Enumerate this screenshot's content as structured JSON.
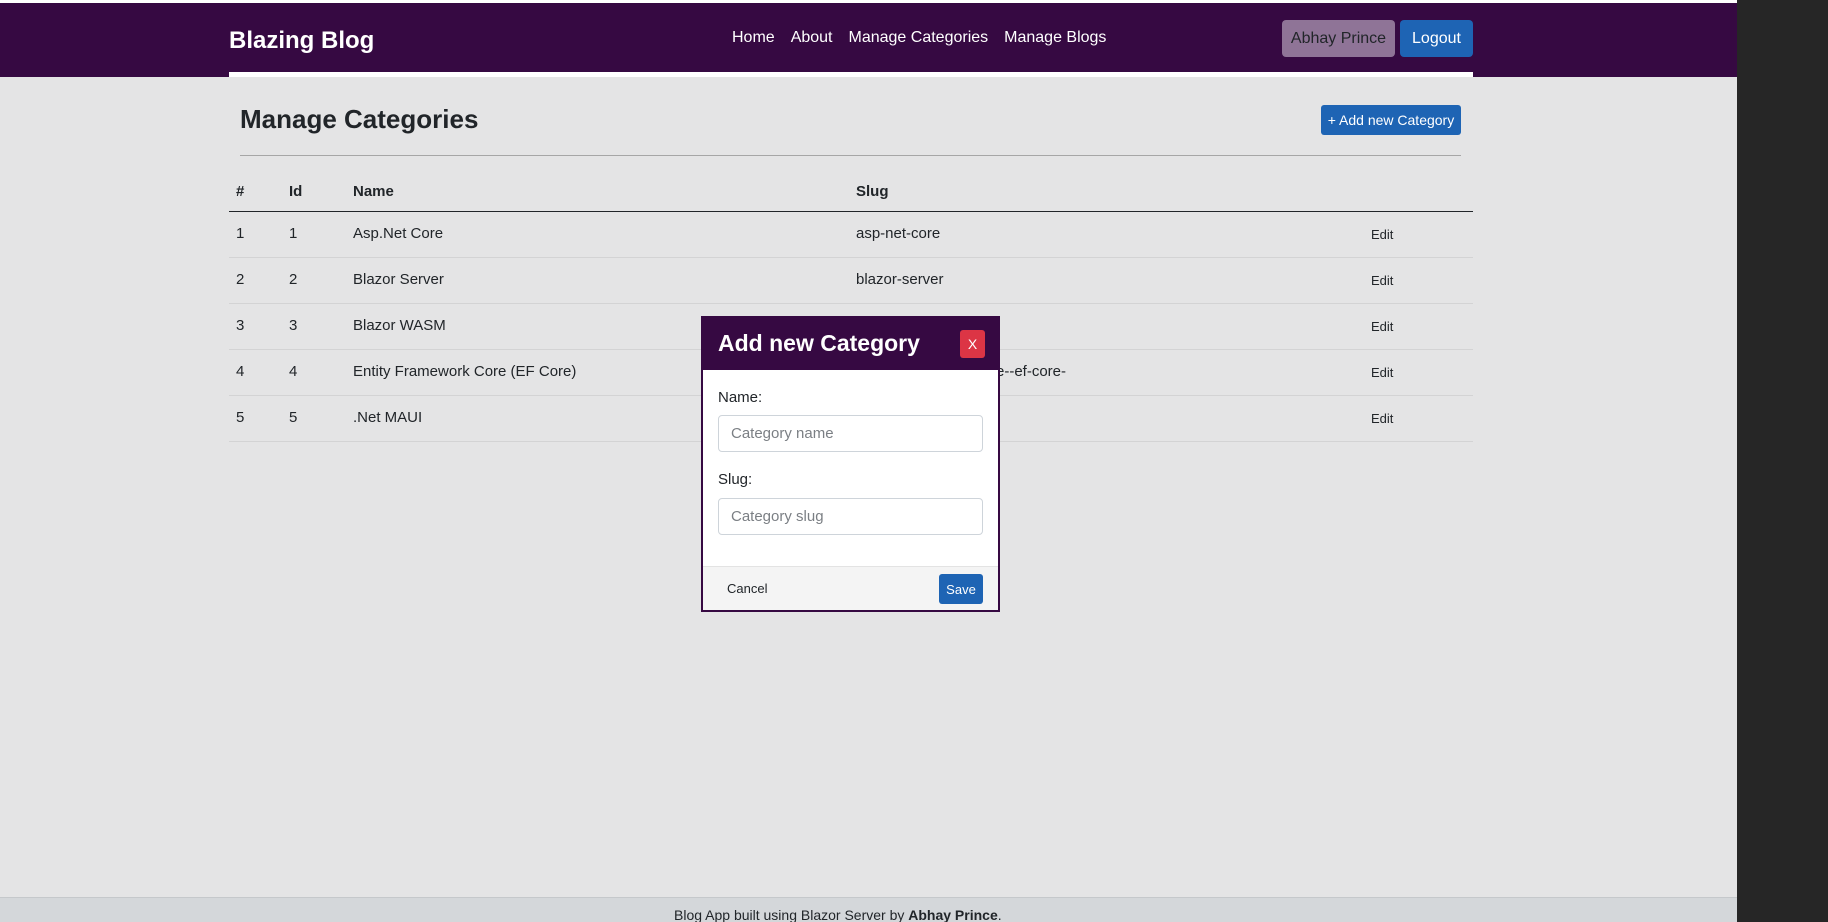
{
  "navbar": {
    "brand": "Blazing Blog",
    "links": [
      "Home",
      "About",
      "Manage Categories",
      "Manage Blogs"
    ],
    "user_name": "Abhay Prince",
    "logout_label": "Logout"
  },
  "main": {
    "title": "Manage Categories",
    "add_button_label": "+ Add new Category",
    "table": {
      "headers": {
        "num": "#",
        "id": "Id",
        "name": "Name",
        "slug": "Slug"
      },
      "rows": [
        {
          "num": "1",
          "id": "1",
          "name": "Asp.Net Core",
          "slug": "asp-net-core",
          "action": "Edit"
        },
        {
          "num": "2",
          "id": "2",
          "name": "Blazor Server",
          "slug": "blazor-server",
          "action": "Edit"
        },
        {
          "num": "3",
          "id": "3",
          "name": "Blazor WASM",
          "slug": "",
          "action": "Edit"
        },
        {
          "num": "4",
          "id": "4",
          "name": "Entity Framework Core (EF Core)",
          "slug": "e--ef-core-",
          "action": "Edit"
        },
        {
          "num": "5",
          "id": "5",
          "name": ".Net MAUI",
          "slug": "",
          "action": "Edit"
        }
      ]
    }
  },
  "modal": {
    "title": "Add new Category",
    "close_label": "X",
    "name_label": "Name:",
    "name_value": "",
    "name_placeholder": "Category name",
    "slug_label": "Slug:",
    "slug_value": "",
    "slug_placeholder": "Category slug",
    "cancel_label": "Cancel",
    "save_label": "Save"
  },
  "footer": {
    "prefix": "Blog App built using Blazor Server by ",
    "author": "Abhay Prince",
    "suffix": "."
  },
  "colors": {
    "navbar_bg": "#360942",
    "primary": "#1e64b4",
    "danger": "#dc3545",
    "page_bg": "#e4e4e5",
    "user_button": "#8f7497"
  }
}
